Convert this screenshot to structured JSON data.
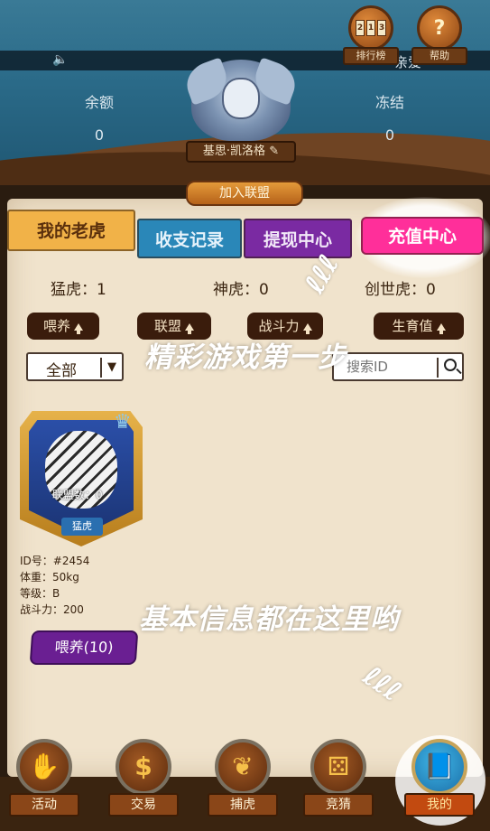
{
  "header": {
    "rank_label": "排行榜",
    "help_label": "帮助",
    "help_glyph": "?",
    "rank_cards": [
      "2",
      "1",
      "3"
    ],
    "qin_text": "亲爱",
    "balance_label": "余额",
    "balance_value": "0",
    "frozen_label": "冻结",
    "frozen_value": "0",
    "username": "基思·凯洛格",
    "edit_glyph": "✎",
    "join_alliance": "加入联盟"
  },
  "tabs": [
    "我的老虎",
    "收支记录",
    "提现中心",
    "充值中心"
  ],
  "active_tab": "充值中心",
  "counts": [
    {
      "label": "猛虎：1"
    },
    {
      "label": "神虎：0"
    },
    {
      "label": "创世虎：0"
    }
  ],
  "sort_buttons": [
    "喂养",
    "联盟",
    "战斗力",
    "生育值"
  ],
  "filter": {
    "value": "全部",
    "chevron": "▼"
  },
  "search": {
    "placeholder": "搜索ID"
  },
  "hints": {
    "top": "精彩游戏第一步",
    "bottom": "基本信息都在这里哟",
    "squiggle": "ℓℓℓ"
  },
  "tiger_card": {
    "alliance": "联盟数：0",
    "type": "猛虎",
    "id": "ID号：#2454",
    "weight": "体重：50kg",
    "level": "等级：B",
    "power": "战斗力：200",
    "feed_button": "喂养(10)"
  },
  "bottom_nav": [
    {
      "label": "活动",
      "icon": "paw-flag-icon",
      "glyph": "✋"
    },
    {
      "label": "交易",
      "icon": "money-bag-icon",
      "glyph": "$"
    },
    {
      "label": "捕虎",
      "icon": "paw-prints-icon",
      "glyph": "❦"
    },
    {
      "label": "竞猜",
      "icon": "dice-icon",
      "glyph": "⚄"
    },
    {
      "label": "我的",
      "icon": "book-icon",
      "glyph": "📘"
    }
  ],
  "active_nav": "我的",
  "colors": {
    "active_tab": "#ff2f9a",
    "tab_tigers": "#f1b248",
    "tab_records": "#2a87b8",
    "tab_withdraw": "#7a2aa2"
  }
}
